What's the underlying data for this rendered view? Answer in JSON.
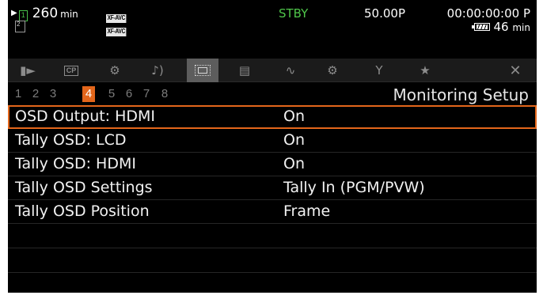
{
  "status_bar": {
    "remaining_time": "260",
    "remaining_unit": "min",
    "format_badges": [
      "XF-AVC",
      "XF-AVC"
    ],
    "slot_number": "1",
    "card2_label": "2",
    "status": "STBY",
    "frame_rate": "50.00P",
    "timecode": "00:00:00:00 P",
    "battery_time": "46",
    "battery_unit": "min"
  },
  "tabs": [
    {
      "name": "camera-icon",
      "glyph": "▸"
    },
    {
      "name": "cp-icon",
      "glyph": "CP"
    },
    {
      "name": "camera-setup-icon",
      "glyph": "⚙"
    },
    {
      "name": "audio-icon",
      "glyph": "♪)"
    },
    {
      "name": "monitoring-icon",
      "glyph": ""
    },
    {
      "name": "recording-icon",
      "glyph": "▤"
    },
    {
      "name": "assist-icon",
      "glyph": "∿"
    },
    {
      "name": "assign-icon",
      "glyph": "⚙"
    },
    {
      "name": "system-icon",
      "glyph": "Y"
    },
    {
      "name": "my-menu-icon",
      "glyph": "★"
    }
  ],
  "close_glyph": "✕",
  "pages": [
    "1",
    "2",
    "3",
    "4",
    "5",
    "6",
    "7",
    "8"
  ],
  "active_page": "4",
  "page_title": "Monitoring Setup",
  "menu_items": [
    {
      "label": "OSD Output: HDMI",
      "value": "On"
    },
    {
      "label": "Tally OSD: LCD",
      "value": "On"
    },
    {
      "label": "Tally OSD: HDMI",
      "value": "On"
    },
    {
      "label": "Tally OSD Settings",
      "value": "Tally In (PGM/PVW)"
    },
    {
      "label": "Tally OSD Position",
      "value": "Frame"
    }
  ],
  "colors": {
    "accent": "#e3661b",
    "status_green": "#4fc64a",
    "background": "#000000"
  }
}
